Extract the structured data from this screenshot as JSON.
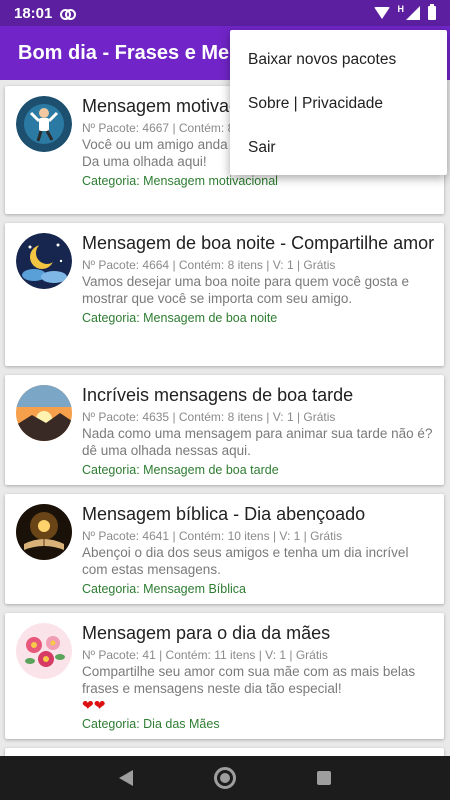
{
  "status_bar": {
    "time": "18:01",
    "network_label": "H"
  },
  "app_bar": {
    "title": "Bom dia - Frases e Mensagens"
  },
  "menu": {
    "items": [
      "Baixar novos pacotes",
      "Sobre | Privacidade",
      "Sair"
    ]
  },
  "cards": [
    {
      "title": "Mensagem motivacional - Frases de Ânimo",
      "meta": "Nº Pacote: 4667 | Contém: 8 itens | V: 1 | Grátis",
      "description": "Você ou um amigo anda passando por situações difíceis? Da uma olhada aqui!",
      "category": "Categoria: Mensagem motivacional",
      "thumb_icon": "motivation-figure-icon"
    },
    {
      "title": "Mensagem de boa noite - Compartilhe amor",
      "meta": "Nº Pacote: 4664 | Contém: 8 itens | V: 1 | Grátis",
      "description": "Vamos desejar uma boa noite para quem você gosta e mostrar que você se importa com seu amigo.",
      "category": "Categoria: Mensagem de boa noite",
      "thumb_icon": "moon-stars-icon"
    },
    {
      "title": "Incríveis mensagens de boa tarde",
      "meta": "Nº Pacote: 4635 | Contém: 8 itens | V: 1 | Grátis",
      "description": "Nada como uma mensagem para animar sua tarde não é? dê uma olhada nessas aqui.",
      "category": "Categoria: Mensagem de boa tarde",
      "thumb_icon": "sunset-icon"
    },
    {
      "title": "Mensagem bíblica - Dia abençoado",
      "meta": "Nº Pacote: 4641 | Contém: 10 itens | V: 1 | Grátis",
      "description": "Abençoi o dia dos seus amigos e tenha um dia incrível com estas mensagens.",
      "category": "Categoria: Mensagem Bíblica",
      "thumb_icon": "bible-icon"
    },
    {
      "title": "Mensagem para o dia da mães",
      "meta": "Nº Pacote: 41 | Contém: 11 itens | V: 1 | Grátis",
      "description": "Compartilhe seu amor com sua mãe com as mais belas frases e mensagens neste dia tão especial!",
      "hearts": "❤❤",
      "category": "Categoria: Dia das Mães",
      "thumb_icon": "flowers-icon"
    }
  ],
  "colors": {
    "status_bar": "#5b1fa0",
    "app_bar": "#7125c8",
    "category_text": "#2e7d32"
  }
}
